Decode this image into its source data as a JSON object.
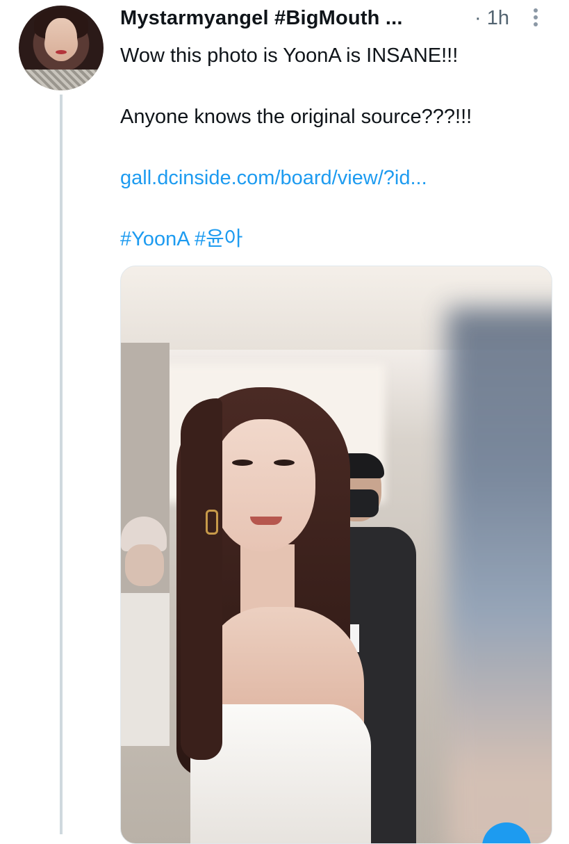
{
  "tweet": {
    "display_name": "Mystarmyangel #BigMouth ...",
    "timestamp": "· 1h",
    "lines": [
      "Wow this photo is YoonA is INSANE!!!",
      "Anyone knows the original source???!!!"
    ],
    "link": "gall.dcinside.com/board/view/?id...",
    "hashtags": [
      "#YoonA",
      "#윤아"
    ]
  },
  "colors": {
    "link": "#1d9bf0",
    "text": "#0f1419",
    "muted": "#536471",
    "thread_line": "#cfd9de"
  },
  "icons": {
    "more": "more-vertical-icon"
  }
}
